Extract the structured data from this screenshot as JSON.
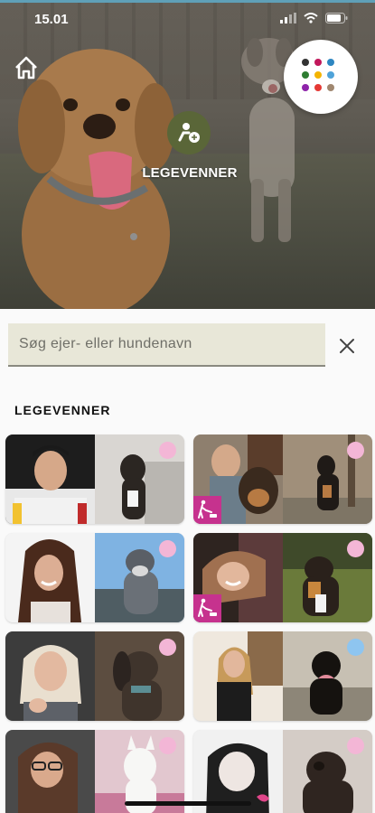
{
  "status_bar": {
    "time": "15.01"
  },
  "header": {
    "play_button_label": "LEGEVENNER",
    "app_dot_colors": [
      "#333333",
      "#c2185b",
      "#2e86c1",
      "#2e7d32",
      "#f4b400",
      "#4fa3d9",
      "#8e24aa",
      "#e53935",
      "#a08770"
    ]
  },
  "search": {
    "placeholder": "Søg ejer- eller hundenavn",
    "value": ""
  },
  "section": {
    "title": "LEGEVENNER"
  },
  "colors": {
    "badge_pink": "#f3b6d6",
    "badge_blue": "#8ec5f0",
    "walk_badge": "#c6328e",
    "search_bg": "#e8e7d8"
  },
  "cards": [
    {
      "status": "pink",
      "walk_badge": false
    },
    {
      "status": "pink",
      "walk_badge": true
    },
    {
      "status": "pink",
      "walk_badge": false
    },
    {
      "status": "pink",
      "walk_badge": true
    },
    {
      "status": "pink",
      "walk_badge": false
    },
    {
      "status": "blue",
      "walk_badge": false
    },
    {
      "status": "pink",
      "walk_badge": false
    },
    {
      "status": "pink",
      "walk_badge": false
    }
  ]
}
